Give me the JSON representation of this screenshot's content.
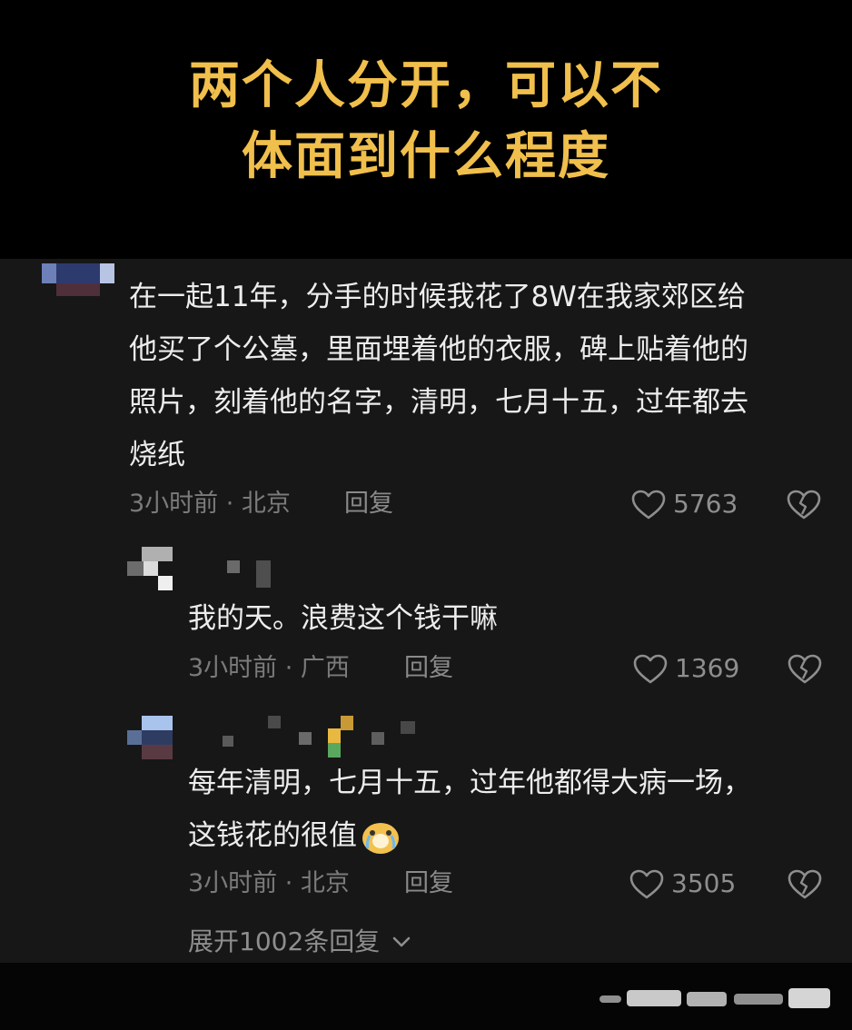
{
  "title": {
    "line1": "两个人分开，可以不",
    "line2": "体面到什么程度"
  },
  "comments": [
    {
      "text_lines": [
        "在一起11年，分手的时候我花了8W在我家郊区给",
        "他买了个公墓，里面埋着他的衣服，碑上贴着他的",
        "照片，刻着他的名字，清明，七月十五，过年都去",
        "烧纸"
      ],
      "meta": "3小时前 · 北京",
      "reply_label": "回复",
      "likes": "5763"
    },
    {
      "text_lines": [
        "我的天。浪费这个钱干嘛"
      ],
      "meta": "3小时前 · 广西",
      "reply_label": "回复",
      "likes": "1369"
    },
    {
      "text_lines": [
        "每年清明，七月十五，过年他都得大病一场，",
        "这钱花的很值"
      ],
      "meta": "3小时前 · 北京",
      "reply_label": "回复",
      "likes": "3505",
      "emoji": "crying-laughing-emoji"
    }
  ],
  "expand_label": "展开1002条回复",
  "icons": {
    "like": "heart-outline-icon",
    "dislike": "broken-heart-icon",
    "expand": "chevron-down-icon"
  },
  "colors": {
    "title": "#f0bf4c",
    "background": "#171717",
    "text": "#ededed",
    "meta": "#7b7b7b"
  }
}
